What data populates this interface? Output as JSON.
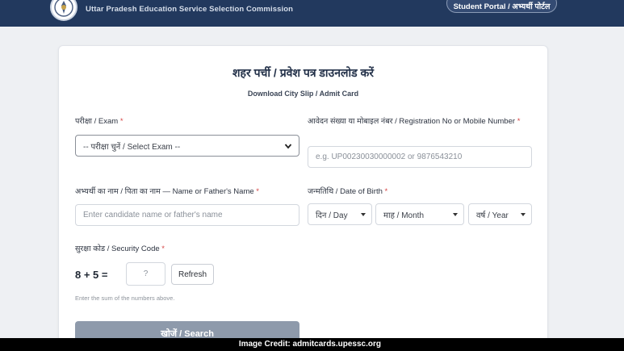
{
  "header": {
    "org_name": "Uttar Pradesh Education Service Selection Commission",
    "portal_button": "Student Portal / अभ्यर्थी पोर्टल"
  },
  "card": {
    "title": "शहर पर्ची / प्रवेश पत्र डाउनलोड करें",
    "subtitle": "Download City Slip / Admit Card"
  },
  "form": {
    "exam": {
      "label": "परीक्षा / Exam",
      "required": "*",
      "selected": "-- परीक्षा चुनें / Select Exam --"
    },
    "registration": {
      "label": "आवेदन संख्या या मोबाइल नंबर / Registration No or Mobile Number",
      "required": "*",
      "placeholder": "e.g. UP00230030000002 or 9876543210"
    },
    "name": {
      "label": "अभ्यर्थी का नाम / पिता का नाम — Name or Father's Name",
      "required": "*",
      "placeholder": "Enter candidate name or father's name"
    },
    "dob": {
      "label": "जन्मतिथि / Date of Birth",
      "required": "*",
      "day": "दिन / Day",
      "month": "माह / Month",
      "year": "वर्ष / Year"
    },
    "security": {
      "label": "सुरक्षा कोड / Security Code",
      "required": "*",
      "question": "8 + 5 =",
      "placeholder": "?",
      "refresh": "Refresh",
      "hint": "Enter the sum of the numbers above."
    },
    "search_button": "खोजें / Search"
  },
  "credit": "Image Credit: admitcards.upessc.org",
  "colors": {
    "header": "#22395e",
    "button_disabled": "#8e9aab",
    "required": "#d64545"
  }
}
